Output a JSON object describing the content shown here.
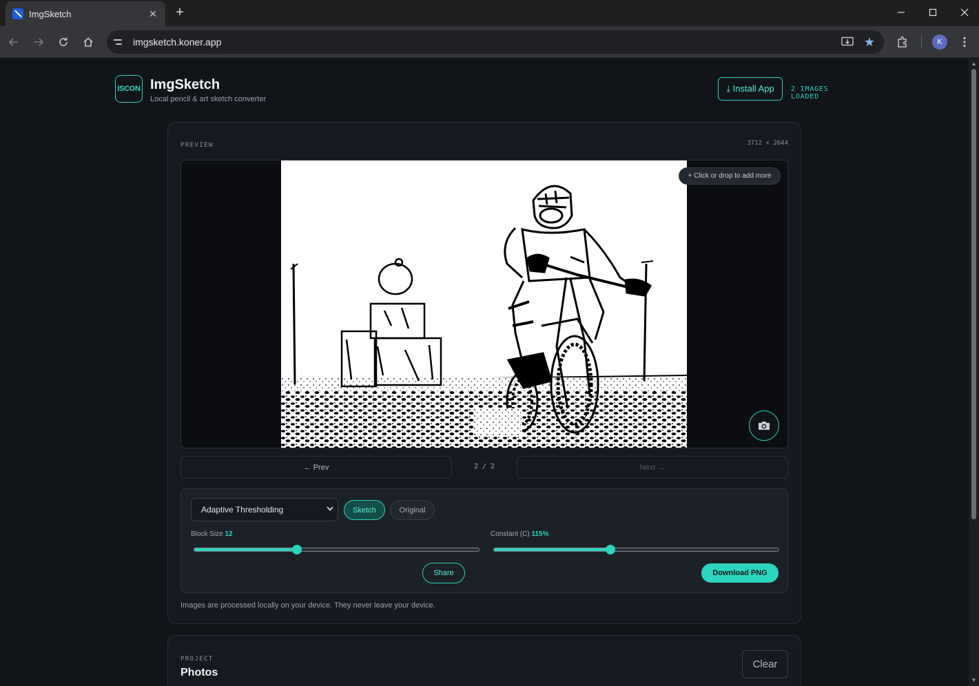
{
  "browser": {
    "tab_title": "ImgSketch",
    "url": "imgsketch.koner.app",
    "profile_initial": "K"
  },
  "app": {
    "logo_text": "ISCON",
    "title": "ImgSketch",
    "subtitle": "Local pencil & art sketch converter",
    "install_label": "⤓ Install App",
    "images_loaded": "2 IMAGES LOADED"
  },
  "preview": {
    "label": "PREVIEW",
    "dimensions": "3712 × 2644",
    "add_more": "+ Click or drop to add more"
  },
  "pager": {
    "prev_label": "← Prev",
    "count": "2 / 2",
    "next_label": "Next →"
  },
  "controls": {
    "mode_selected": "Adaptive Thresholding",
    "sketch_label": "Sketch",
    "original_label": "Original",
    "block_size_label": "Block Size",
    "block_size_value": "12",
    "block_size_fraction": 0.36,
    "constant_label": "Constant (C)",
    "constant_value": "115%",
    "constant_fraction": 0.41,
    "share_label": "Share",
    "download_label": "Download PNG"
  },
  "privacy_note": "Images are processed locally on your device. They never leave your device.",
  "project": {
    "label": "PROJECT",
    "title": "Photos",
    "clear_label": "Clear"
  },
  "colors": {
    "accent": "#2dd4bf",
    "background": "#111419",
    "card": "#161a20"
  }
}
